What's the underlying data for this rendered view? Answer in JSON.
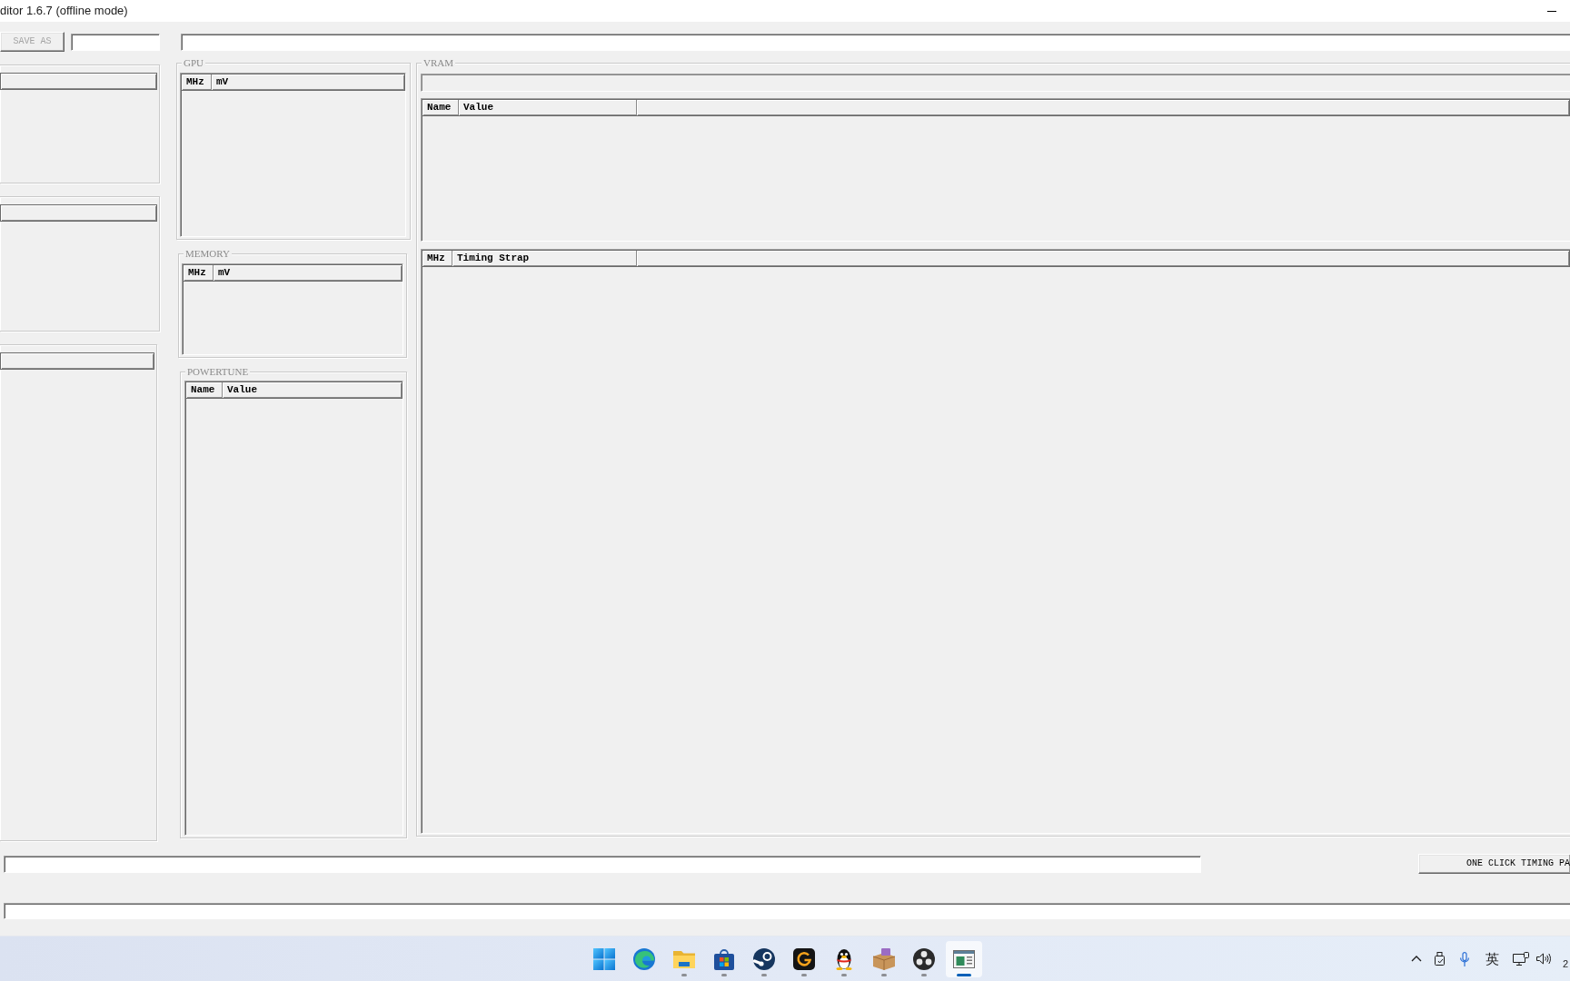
{
  "window": {
    "title": "ditor 1.6.7 (offline mode)"
  },
  "toolbar": {
    "save_as_button": {
      "label": "SAVE AS",
      "disabled": true
    }
  },
  "gpu": {
    "title": "GPU",
    "columns": [
      "MHz",
      "mV"
    ]
  },
  "memory": {
    "title": "MEMORY",
    "columns": [
      "MHz",
      "mV"
    ]
  },
  "powertune": {
    "title": "POWERTUNE",
    "columns": [
      "Name",
      "Value"
    ]
  },
  "vram": {
    "title": "VRAM",
    "table": {
      "columns": [
        "Name",
        "Value"
      ]
    },
    "timings": {
      "columns": [
        "MHz",
        "Timing Strap"
      ]
    }
  },
  "bottom": {
    "timing_button": {
      "label": "ONE CLICK TIMING PA",
      "disabled": false
    }
  },
  "taskbar": {
    "apps": [
      {
        "running": false,
        "selected": false
      },
      {
        "running": false,
        "selected": false
      },
      {
        "running": true,
        "selected": false
      },
      {
        "running": true,
        "selected": false
      },
      {
        "running": true,
        "selected": false
      },
      {
        "running": true,
        "selected": false
      },
      {
        "running": true,
        "selected": false
      },
      {
        "running": true,
        "selected": false
      },
      {
        "running": true,
        "selected": false
      },
      {
        "running": true,
        "selected": true
      }
    ],
    "tray": {
      "input_language": "英",
      "clock": "2"
    }
  }
}
